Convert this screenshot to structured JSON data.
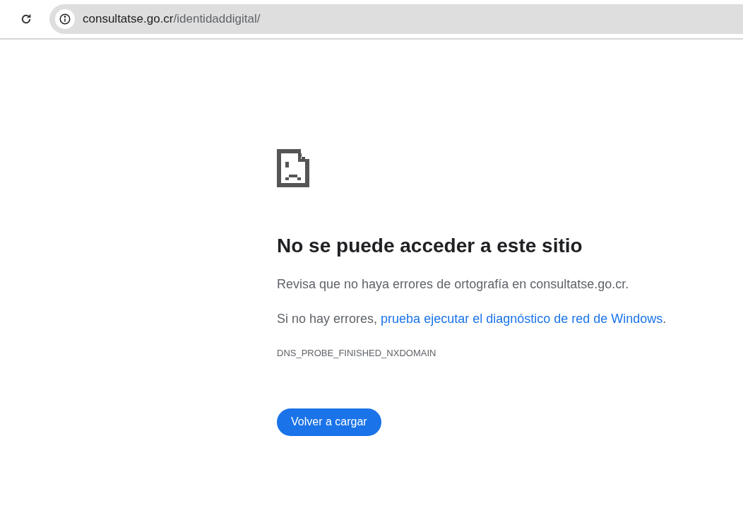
{
  "toolbar": {
    "url_host": "consultatse.go.cr",
    "url_path": "/identidaddigital/"
  },
  "error": {
    "title": "No se puede acceder a este sitio",
    "hint": "Revisa que no haya errores de ortografía en consultatse.go.cr.",
    "suggestion": {
      "before": "Si no hay errores, ",
      "link": "prueba ejecutar el diagnóstico de red de Windows",
      "after": "."
    },
    "code": "DNS_PROBE_FINISHED_NXDOMAIN",
    "button": "Volver a cargar"
  }
}
